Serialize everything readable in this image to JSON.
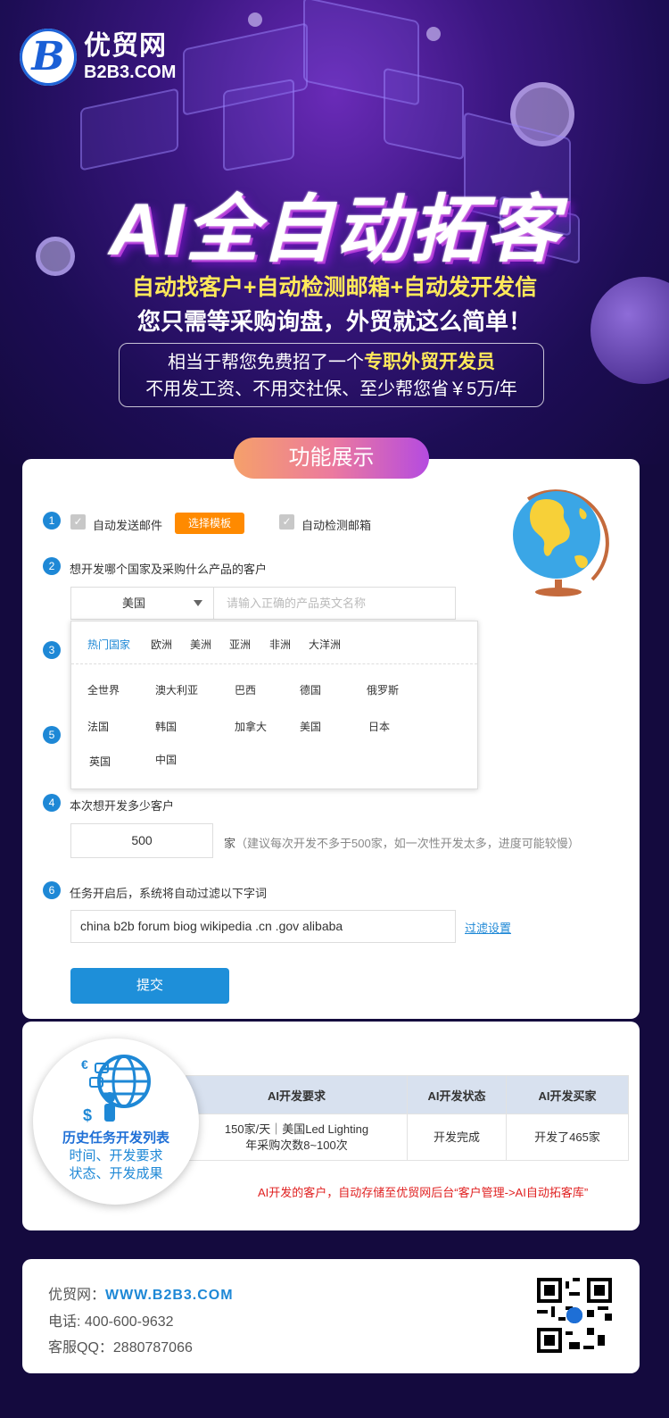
{
  "header": {
    "logo_cn": "优贸网",
    "logo_en": "B2B3.COM",
    "logo_mark": "B",
    "title": "AI全自动拓客",
    "subtitle1": "自动找客户+自动检测邮箱+自动发开发信",
    "subtitle2": "您只需等采购询盘，外贸就这么简单！",
    "box_line1_prefix": "相当于帮您免费招了一个",
    "box_line1_highlight": "专职外贸开发员",
    "box_line2": "不用发工资、不用交社保、至少帮您省￥5万/年"
  },
  "section_title": "功能展示",
  "form": {
    "step_numbers": [
      "1",
      "2",
      "3",
      "5",
      "4",
      "6"
    ],
    "auto_send_label": "自动发送邮件",
    "choose_template": "选择模板",
    "auto_check_label": "自动检测邮箱",
    "step2_label": "想开发哪个国家及采购什么产品的客户",
    "country_selected": "美国",
    "product_placeholder": "请输入正确的产品英文名称",
    "dropdown_tabs": [
      "热门国家",
      "欧洲",
      "美洲",
      "亚洲",
      "非洲",
      "大洋洲"
    ],
    "dropdown_countries": [
      "全世界",
      "澳大利亚",
      "巴西",
      "德国",
      "俄罗斯",
      "法国",
      "韩国",
      "加拿大",
      "美国",
      "日本",
      "英国",
      "中国"
    ],
    "step4_label": "本次想开发多少客户",
    "count_value": "500",
    "count_unit": "家",
    "count_hint": "（建议每次开发不多于500家，如一次性开发太多，进度可能较慢）",
    "step6_label": "任务开启后，系统将自动过滤以下字词",
    "filter_value": "china b2b forum biog wikipedia .cn .gov alibaba",
    "filter_link": "过滤设置",
    "submit_label": "提交"
  },
  "history": {
    "title": "历史任务开发列表",
    "line2": "时间、开发要求",
    "line3": "状态、开发成果",
    "columns": [
      "AI开发要求",
      "AI开发状态",
      "AI开发买家"
    ],
    "row": [
      "150家/天｜美国Led Lighting",
      "年采购次数8~100次",
      "开发完成",
      "开发了465家"
    ],
    "note": "AI开发的客户，自动存储至优贸网后台“客户管理->AI自动拓客库”"
  },
  "footer": {
    "site_label": "优贸网：",
    "site_url": "WWW.B2B3.COM",
    "phone": "电话: 400-600-9632",
    "qq": "客服QQ：2880787066"
  },
  "colors": {
    "accent_blue": "#1e88d6",
    "orange": "#ff8a00",
    "highlight_yellow": "#ffe95a",
    "note_red": "#e02020",
    "bg_dark": "#140a3e"
  }
}
